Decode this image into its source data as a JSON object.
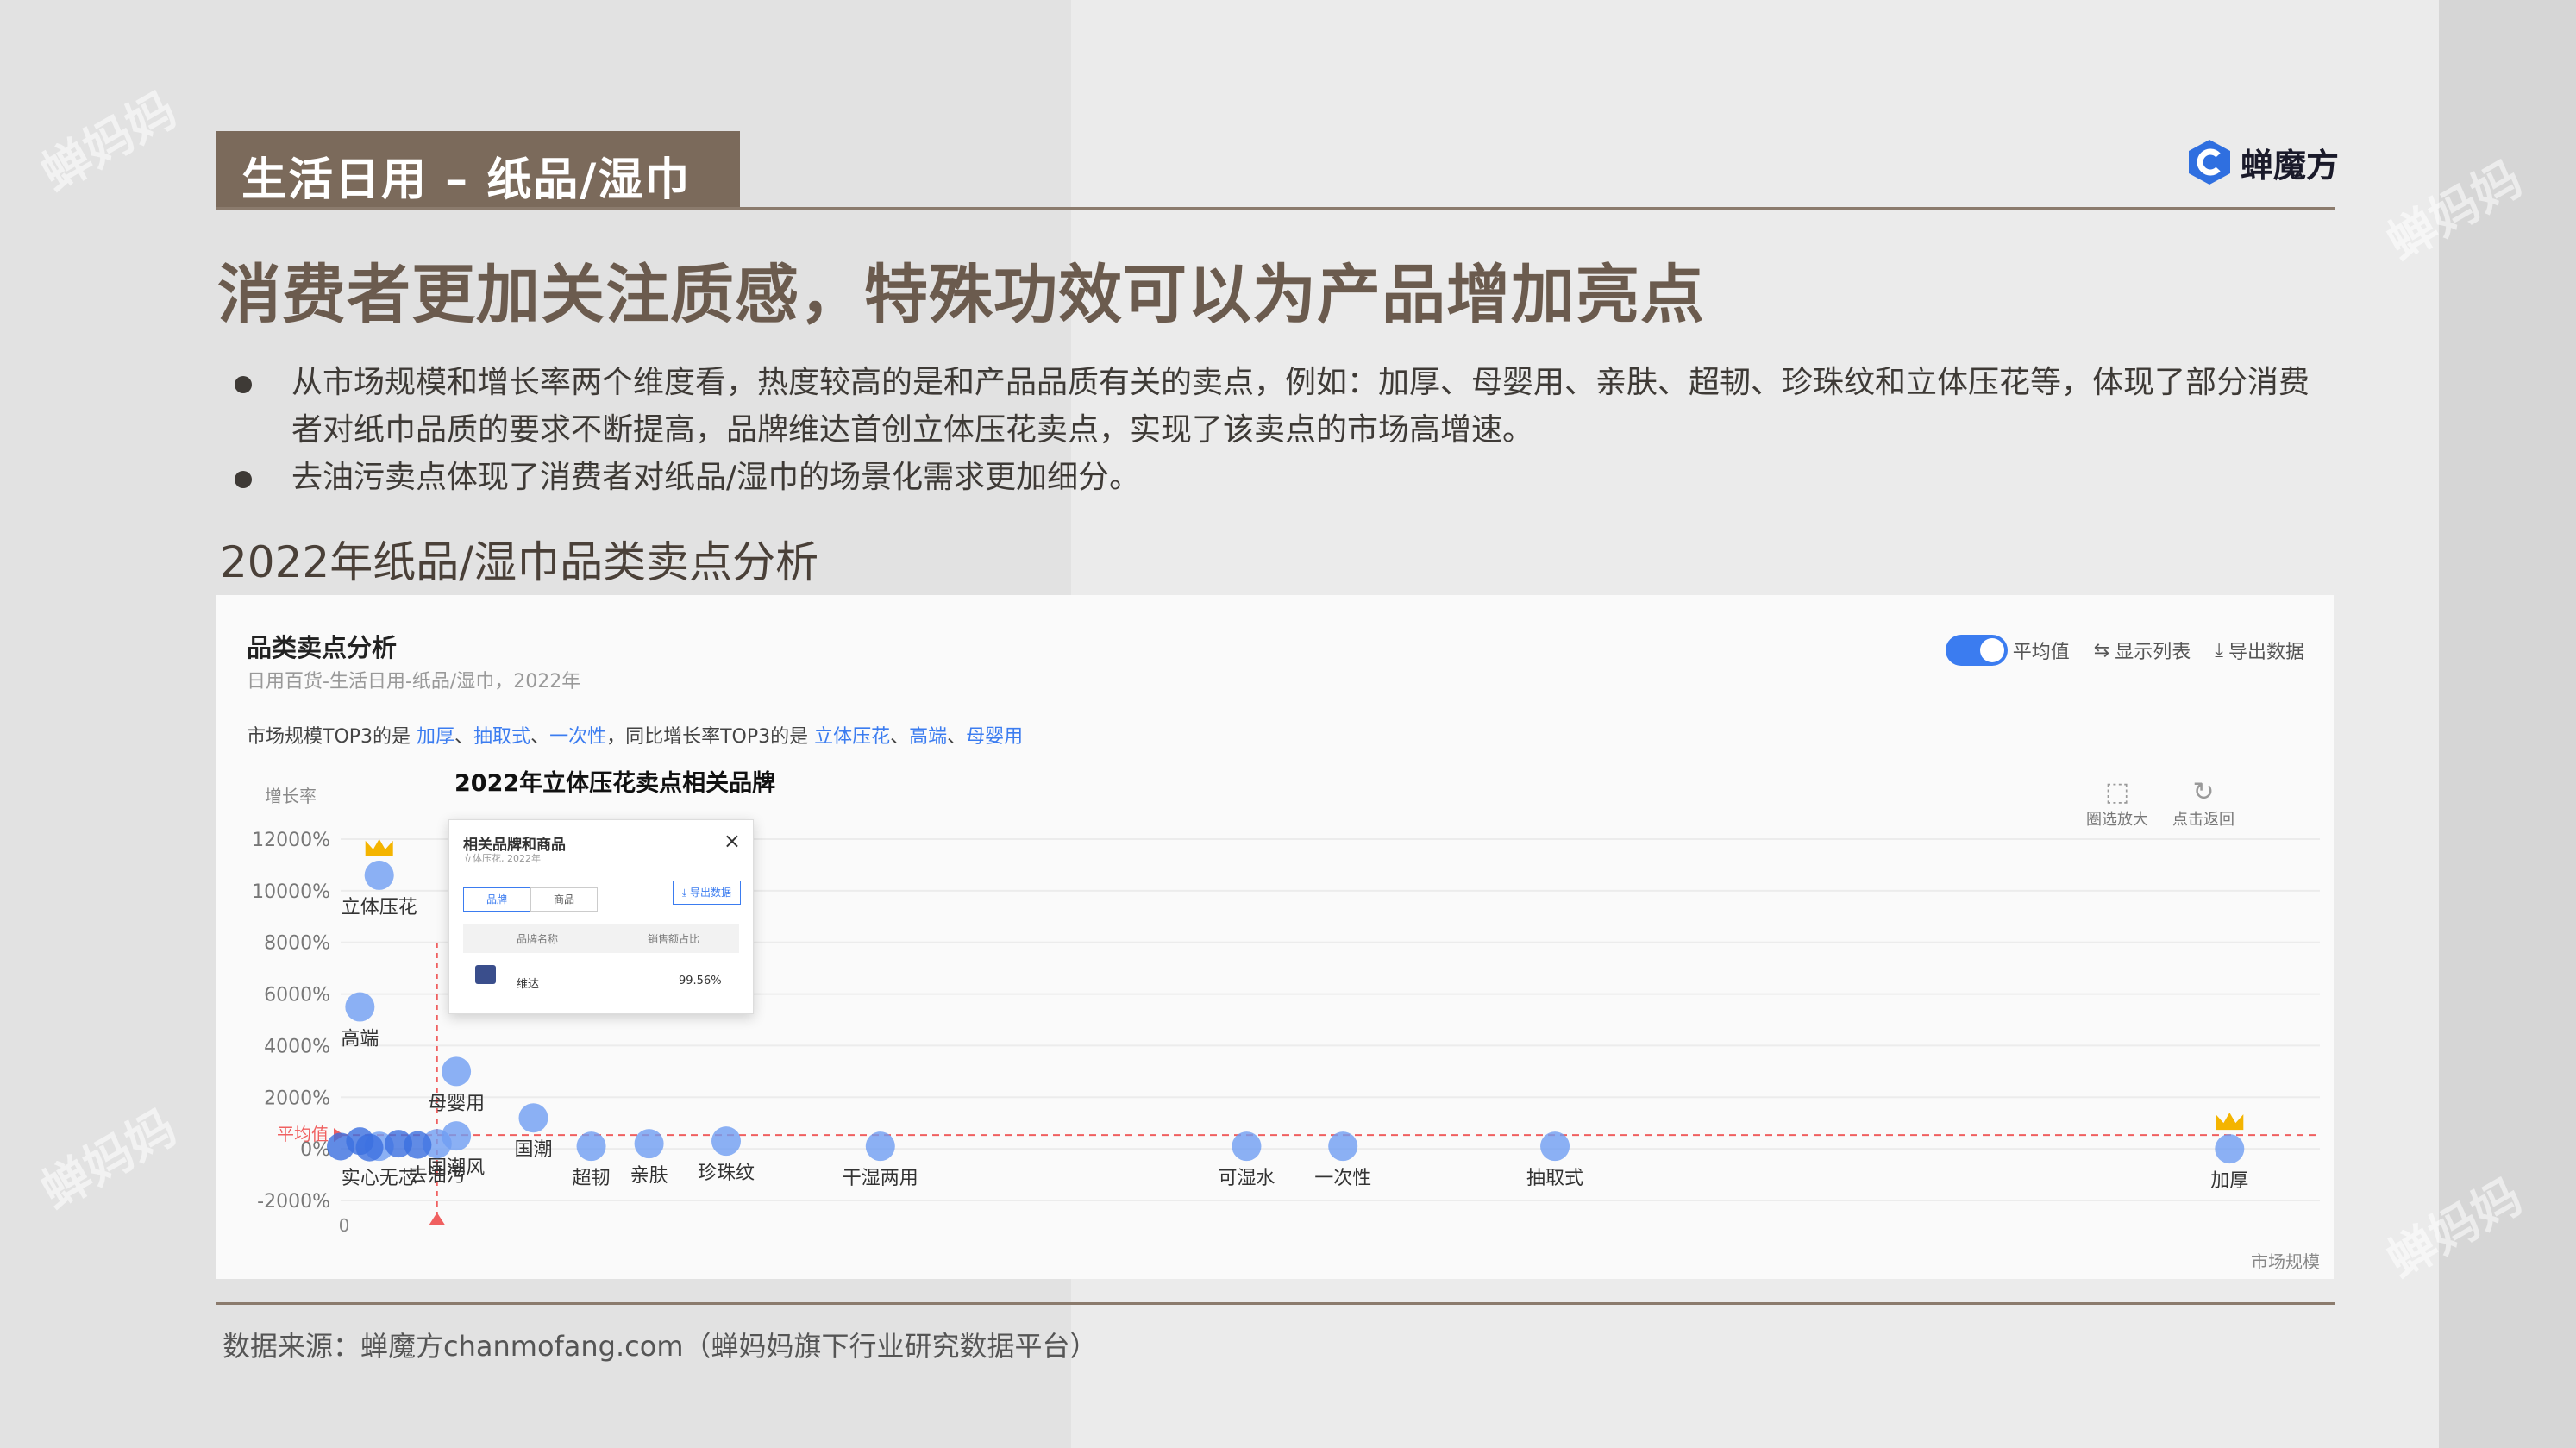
{
  "section_tag": "生活日用 – 纸品/湿巾",
  "brand_logo_text": "蝉魔方",
  "headline": "消费者更加关注质感，特殊功效可以为产品增加亮点",
  "bullets": [
    "从市场规模和增长率两个维度看，热度较高的是和产品品质有关的卖点，例如：加厚、母婴用、亲肤、超韧、珍珠纹和立体压花等，体现了部分消费者对纸巾品质的要求不断提高，品牌维达首创立体压花卖点，实现了该卖点的市场高增速。",
    "去油污卖点体现了消费者对纸品/湿巾的场景化需求更加细分。"
  ],
  "subheading": "2022年纸品/湿巾品类卖点分析",
  "panel": {
    "title": "品类卖点分析",
    "subtitle": "日用百货-生活日用-纸品/湿巾，2022年",
    "toggle_label": "平均值",
    "show_list_label": "显示列表",
    "export_label": "导出数据",
    "summary": {
      "prefix": "市场规模TOP3的是 ",
      "market_top3": [
        "加厚",
        "抽取式",
        "一次性"
      ],
      "middle": "，同比增长率TOP3的是 ",
      "growth_top3": [
        "立体压花",
        "高端",
        "母婴用"
      ]
    },
    "annotation": "2022年立体压花卖点相关品牌",
    "zoom_label": "圈选放大",
    "reset_label": "点击返回"
  },
  "popup": {
    "title": "相关品牌和商品",
    "subtitle": "立体压花, 2022年",
    "tab_brand": "品牌",
    "tab_product": "商品",
    "export": "导出数据",
    "col_brand": "品牌名称",
    "col_share": "销售额占比",
    "row_brand": "维达",
    "row_share": "99.56%"
  },
  "chart_data": {
    "type": "scatter",
    "ylabel": "增长率",
    "xlabel": "市场规模",
    "y_ticks": [
      "12000%",
      "10000%",
      "8000%",
      "6000%",
      "4000%",
      "2000%",
      "0%",
      "-2000%"
    ],
    "x_tick": "0",
    "ylim": [
      -2000,
      12000
    ],
    "average_label": "平均值",
    "average_value": 0,
    "points": [
      {
        "label": "立体压花",
        "x": 0.02,
        "y": 10600
      },
      {
        "label": "高端",
        "x": 0.01,
        "y": 5500
      },
      {
        "label": "母婴用",
        "x": 0.06,
        "y": 3000
      },
      {
        "label": "国潮",
        "x": 0.1,
        "y": 1200
      },
      {
        "label": "国潮风",
        "x": 0.06,
        "y": 500
      },
      {
        "label": "去油污",
        "x": 0.05,
        "y": 200
      },
      {
        "label": "实心无芯",
        "x": 0.02,
        "y": 100
      },
      {
        "label": "超韧",
        "x": 0.13,
        "y": 100
      },
      {
        "label": "亲肤",
        "x": 0.16,
        "y": 200
      },
      {
        "label": "珍珠纹",
        "x": 0.2,
        "y": 300
      },
      {
        "label": "干湿两用",
        "x": 0.28,
        "y": 100
      },
      {
        "label": "可湿水",
        "x": 0.47,
        "y": 100
      },
      {
        "label": "一次性",
        "x": 0.52,
        "y": 100
      },
      {
        "label": "抽取式",
        "x": 0.63,
        "y": 100
      },
      {
        "label": "加厚",
        "x": 0.98,
        "y": 0
      }
    ],
    "crowned": [
      "立体压花",
      "加厚"
    ]
  },
  "source": "数据来源：蝉魔方chanmofang.com（蝉妈妈旗下行业研究数据平台）",
  "watermark": "蝉妈妈",
  "colors": {
    "accent": "#7b6a5b",
    "point": "#6f9ef3",
    "average_line": "#f06060",
    "link": "#3b7cf0"
  }
}
